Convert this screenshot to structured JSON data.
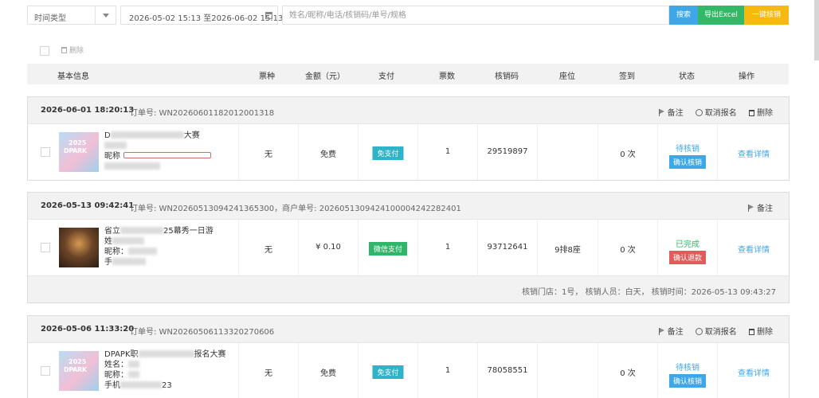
{
  "filter": {
    "type_select": "时间类型",
    "date_range": "2026-05-02 15:13 至2026-06-02 15:13",
    "search_placeholder": "姓名/昵称/电话/核销码/单号/规格",
    "search_button": "搜索",
    "export_button": "导出Excel",
    "verify_all_button": "一键核销"
  },
  "toolbar": {
    "delete_label": "删除"
  },
  "columns": [
    "基本信息",
    "票种",
    "金额（元）",
    "支付",
    "票数",
    "核销码",
    "座位",
    "签到",
    "状态",
    "操作"
  ],
  "orders": [
    {
      "datetime": "2026-06-01 18:20:13",
      "order_no": "订单号: WN20260601182012001318",
      "actions": [
        "备注",
        "取消报名",
        "删除"
      ],
      "info": {
        "title_prefix": "D",
        "title_suffix": "大赛",
        "line2_prefix": "",
        "nickname_prefix": "昵称",
        "phone_prefix": "",
        "phone_suffix": ""
      },
      "ticket_type": "无",
      "amount": "免费",
      "payment": "免支付",
      "quantity": "1",
      "verify_code": "29519897",
      "seat": "",
      "checkin": "0 次",
      "status": "待核销",
      "status_action": "确认核销",
      "detail_link": "查看详情"
    },
    {
      "datetime": "2026-05-13 09:42:41",
      "order_no": "订单号: WN20260513094241365300，商户单号: 2026051309424100004242282401",
      "actions": [
        "备注"
      ],
      "info": {
        "title_prefix": "省立",
        "title_suffix": "25幕秀一日游",
        "line2_prefix": "姓",
        "nickname_prefix": "昵称：",
        "phone_prefix": "手",
        "phone_suffix": ""
      },
      "ticket_type": "无",
      "amount": "¥ 0.10",
      "payment": "微信支付",
      "quantity": "1",
      "verify_code": "93712641",
      "seat": "9排8座",
      "checkin": "0 次",
      "status": "已完成",
      "status_action": "确认退款",
      "detail_link": "查看详情",
      "footer": "核销门店：1号，  核销人员：白天，  核销时间：2026-05-13 09:43:27"
    },
    {
      "datetime": "2026-05-06 11:33:20",
      "order_no": "订单号: WN20260506113320270606",
      "actions": [
        "备注",
        "取消报名",
        "删除"
      ],
      "info": {
        "title_prefix": "DPAPK职",
        "title_suffix": "报名大赛",
        "line2_prefix": "姓名：",
        "nickname_prefix": "昵称：",
        "phone_prefix": "手机",
        "phone_suffix": "23"
      },
      "ticket_type": "无",
      "amount": "免费",
      "payment": "免支付",
      "quantity": "1",
      "verify_code": "78058551",
      "seat": "",
      "checkin": "0 次",
      "status": "待核销",
      "status_action": "确认核销",
      "detail_link": "查看详情"
    }
  ]
}
